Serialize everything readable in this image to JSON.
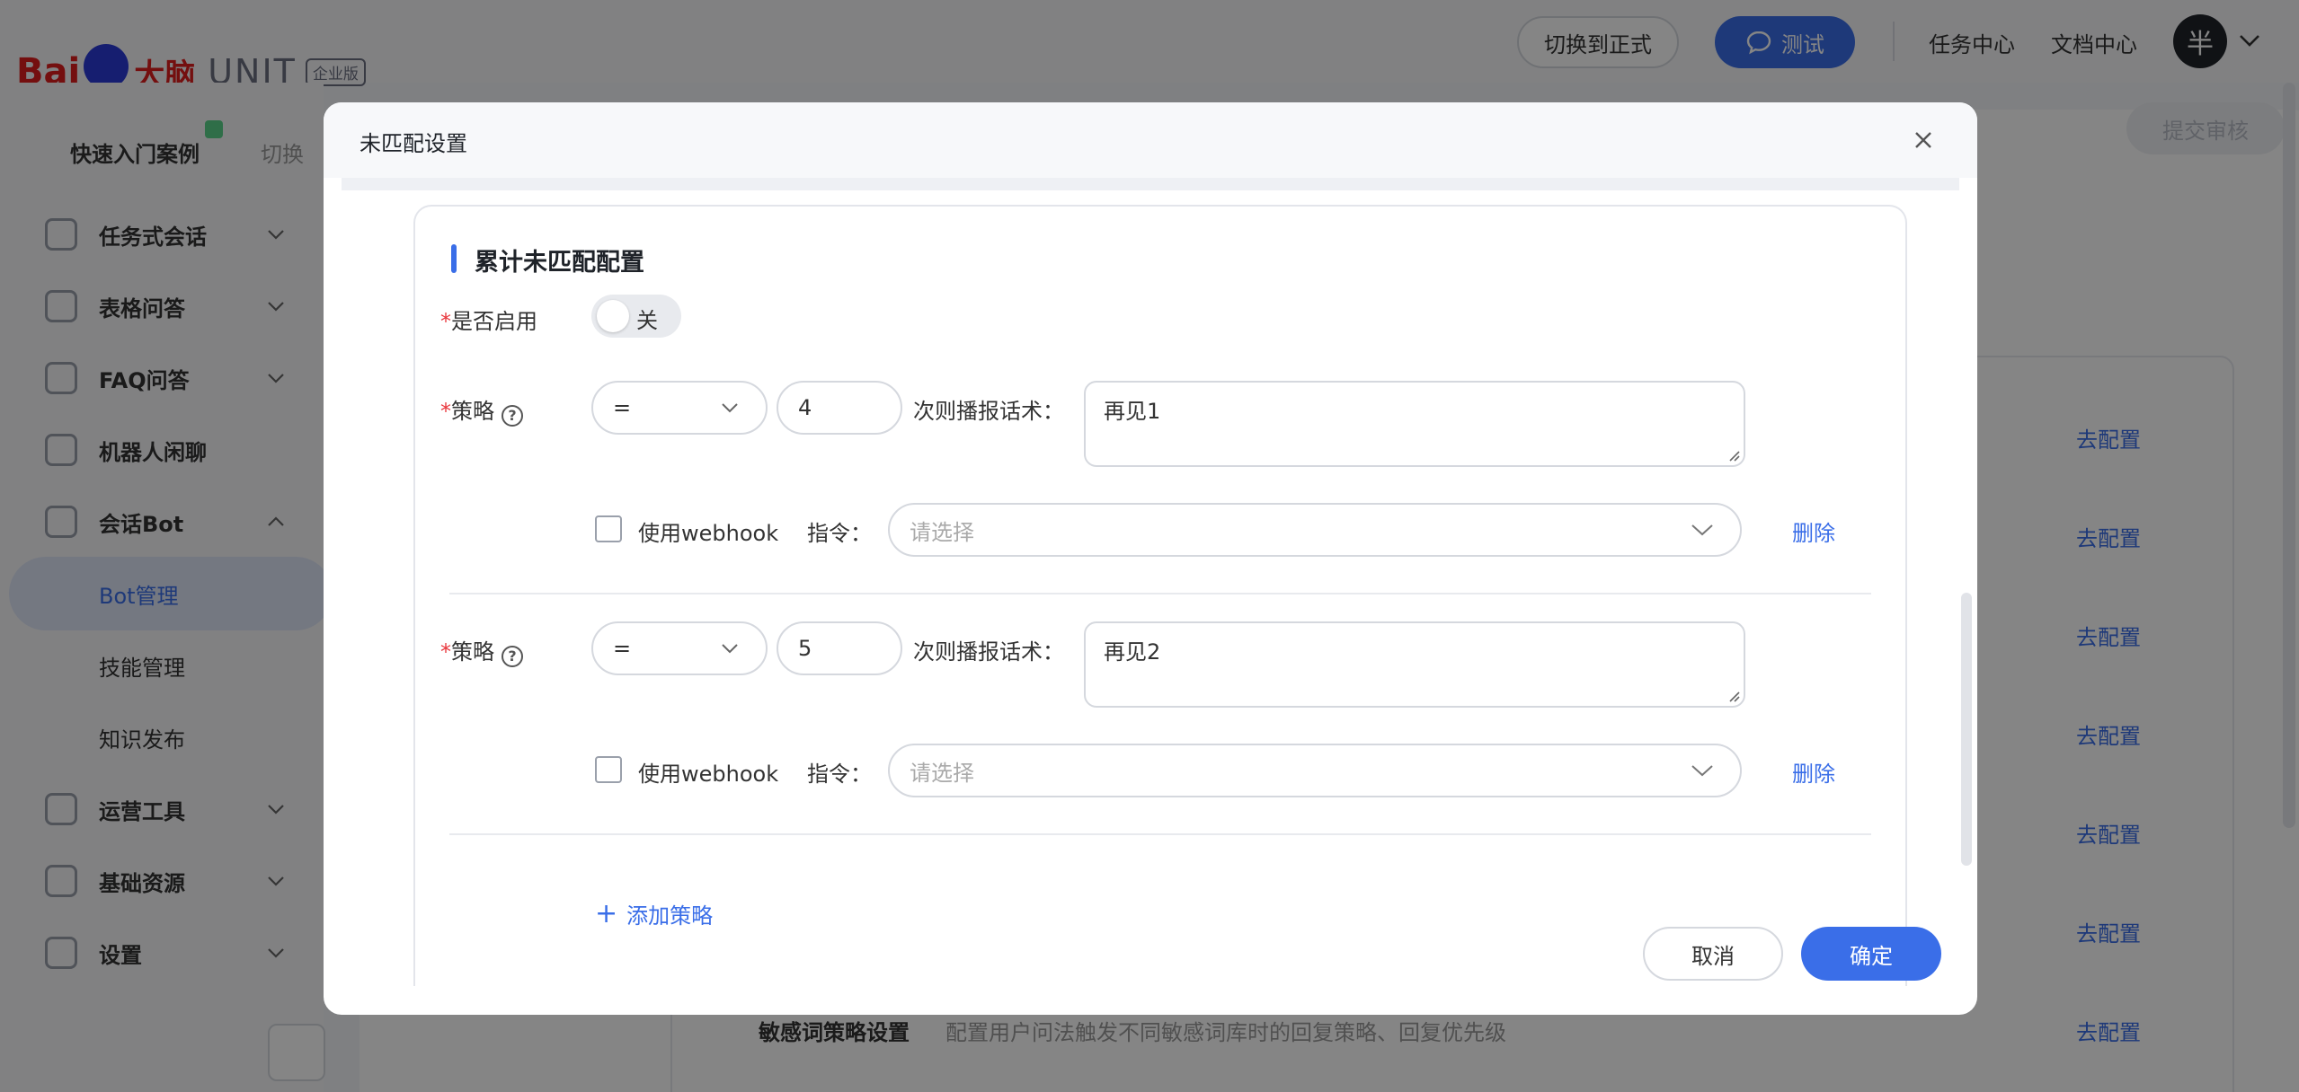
{
  "header": {
    "logo_baidu": "Bai",
    "logo_brain": "大脑",
    "logo_unit": "UNIT",
    "logo_edition": "企业版",
    "switch_formal": "切换到正式",
    "test": "测试",
    "task_center": "任务中心",
    "doc_center": "文档中心",
    "avatar": "半"
  },
  "sidebar": {
    "project": "快速入门案例",
    "switch": "切换",
    "items": [
      {
        "label": "任务式会话"
      },
      {
        "label": "表格问答"
      },
      {
        "label": "FAQ问答"
      },
      {
        "label": "机器人闲聊"
      },
      {
        "label": "会话Bot"
      },
      {
        "label": "运营工具"
      },
      {
        "label": "基础资源"
      },
      {
        "label": "设置"
      }
    ],
    "sub_items": [
      {
        "label": "Bot管理"
      },
      {
        "label": "技能管理"
      },
      {
        "label": "知识发布"
      }
    ]
  },
  "background": {
    "submit_review": "提交审核",
    "goto_config": "去配置",
    "row_title": "敏感词策略设置",
    "row_desc": "配置用户问法触发不同敏感词库时的回复策略、回复优先级"
  },
  "modal": {
    "title": "未匹配设置",
    "section_title": "累计未匹配配置",
    "enable_label": "是否启用",
    "enable_value": "关",
    "strategy_label": "策略",
    "times_label": "次则播报话术：",
    "webhook_label": "使用webhook",
    "command_label": "指令：",
    "command_placeholder": "请选择",
    "delete": "删除",
    "add_strategy": "添加策略",
    "cancel": "取消",
    "confirm": "确定",
    "strategies": [
      {
        "operator": "=",
        "count": "4",
        "reply": "再见1"
      },
      {
        "operator": "=",
        "count": "5",
        "reply": "再见2"
      }
    ]
  },
  "colors": {
    "primary": "#3a6ee8",
    "required": "#e8373d"
  }
}
